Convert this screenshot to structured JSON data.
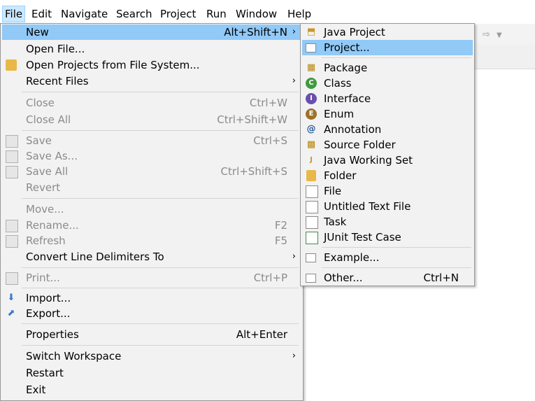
{
  "menubar": {
    "items": [
      "File",
      "Edit",
      "Navigate",
      "Search",
      "Project",
      "Run",
      "Window",
      "Help"
    ]
  },
  "file_menu": {
    "new": {
      "label": "New",
      "shortcut": "Alt+Shift+N"
    },
    "open_file": "Open File...",
    "open_projects": "Open Projects from File System...",
    "recent_files": "Recent Files",
    "close": {
      "label": "Close",
      "shortcut": "Ctrl+W"
    },
    "close_all": {
      "label": "Close All",
      "shortcut": "Ctrl+Shift+W"
    },
    "save": {
      "label": "Save",
      "shortcut": "Ctrl+S"
    },
    "save_as": "Save As...",
    "save_all": {
      "label": "Save All",
      "shortcut": "Ctrl+Shift+S"
    },
    "revert": "Revert",
    "move": "Move...",
    "rename": {
      "label": "Rename...",
      "shortcut": "F2"
    },
    "refresh": {
      "label": "Refresh",
      "shortcut": "F5"
    },
    "convert": "Convert Line Delimiters To",
    "print": {
      "label": "Print...",
      "shortcut": "Ctrl+P"
    },
    "import": "Import...",
    "export": "Export...",
    "properties": {
      "label": "Properties",
      "shortcut": "Alt+Enter"
    },
    "switch_workspace": "Switch Workspace",
    "restart": "Restart",
    "exit": "Exit"
  },
  "new_menu": {
    "java_project": "Java Project",
    "project": "Project...",
    "package": "Package",
    "class": "Class",
    "interface": "Interface",
    "enum": "Enum",
    "annotation": "Annotation",
    "source_folder": "Source Folder",
    "java_working_set": "Java Working Set",
    "folder": "Folder",
    "file": "File",
    "untitled_text_file": "Untitled Text File",
    "task": "Task",
    "junit_test_case": "JUnit Test Case",
    "example": "Example...",
    "other": {
      "label": "Other...",
      "shortcut": "Ctrl+N"
    }
  },
  "colors": {
    "highlight": "#91c9f7",
    "menubar_active": "#cce8ff",
    "menu_bg": "#f2f2f2",
    "disabled_text": "#8b8b8b"
  }
}
